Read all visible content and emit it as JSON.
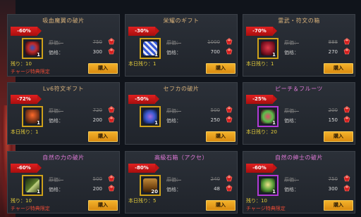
{
  "colors": {
    "accent": "#f3b12a",
    "discount": "#e02020",
    "remaining": "#e7cf3a",
    "note": "#e94a35"
  },
  "labels": {
    "original_price": "原価：",
    "current_price": "価格：",
    "buy": "購入"
  },
  "items": [
    {
      "title": "吸血魔翼の破片",
      "discount": "-60%",
      "orig": "750",
      "price": "300",
      "qty": "1",
      "remaining": "残り：10",
      "note": "チャージ特典限定",
      "frame": "gold",
      "icon": "wing-shard-icon"
    },
    {
      "title": "栄耀のギフト",
      "discount": "-30%",
      "orig": "1000",
      "price": "700",
      "qty": "1",
      "remaining": "本日残り：1",
      "note": "",
      "frame": "gold",
      "icon": "gift-box-icon"
    },
    {
      "title": "霊武・符文の箱",
      "discount": "-70%",
      "orig": "888",
      "price": "270",
      "qty": "1",
      "remaining": "本日残り：1",
      "note": "",
      "frame": "gold",
      "icon": "rune-box-icon"
    },
    {
      "title": "Lv6符文ギフト",
      "discount": "-72%",
      "orig": "720",
      "price": "200",
      "qty": "1",
      "remaining": "本日残り：1",
      "note": "",
      "frame": "gold",
      "icon": "rune-gift-icon"
    },
    {
      "title": "セフカの破片",
      "discount": "-50%",
      "orig": "500",
      "price": "250",
      "qty": "1",
      "remaining": "",
      "note": "",
      "frame": "gold",
      "icon": "sefka-shard-icon"
    },
    {
      "title": "ピーチ＆フルーツ",
      "discount": "-25%",
      "orig": "200",
      "price": "150",
      "qty": "1",
      "remaining": "本日残り：20",
      "note": "",
      "frame": "purple",
      "icon": "fruit-icon"
    },
    {
      "title": "自然の力の破片",
      "discount": "-60%",
      "orig": "500",
      "price": "200",
      "qty": "1",
      "remaining": "残り：10",
      "note": "チャージ特典限定",
      "frame": "gold",
      "icon": "nature-shard-icon"
    },
    {
      "title": "高級石箱（アクセ）",
      "discount": "-80%",
      "orig": "240",
      "price": "48",
      "qty": "20",
      "remaining": "本日残り：5",
      "note": "",
      "frame": "gold",
      "icon": "chest-icon"
    },
    {
      "title": "自然の紳士の破片",
      "discount": "-60%",
      "orig": "750",
      "price": "300",
      "qty": "1",
      "remaining": "残り：10",
      "note": "チャージ特典限定",
      "frame": "purple",
      "icon": "gentleman-shard-icon"
    }
  ]
}
